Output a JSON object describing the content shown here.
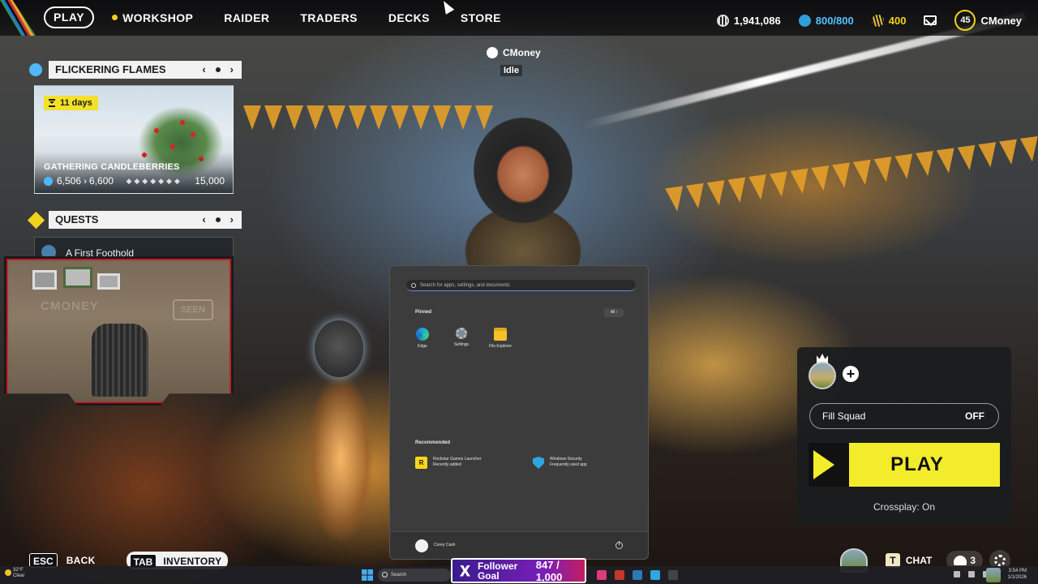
{
  "nav": {
    "play": "PLAY",
    "items": [
      "WORKSHOP",
      "RAIDER",
      "TRADERS",
      "DECKS",
      "STORE"
    ]
  },
  "currencies": {
    "coins": "1,941,086",
    "energy": "800/800",
    "tokens": "400"
  },
  "profile": {
    "level": "45",
    "username": "CMoney"
  },
  "player_tag": {
    "name": "CMoney",
    "status": "Idle"
  },
  "event": {
    "title": "FLICKERING FLAMES",
    "time_left": "11 days",
    "challenge": "GATHERING CANDLEBERRIES",
    "progress_current": "6,506",
    "progress_next": "6,600",
    "progress_max": "15,000"
  },
  "quests": {
    "title": "QUESTS",
    "first_quest": "A First Foothold"
  },
  "webcam": {
    "wall_text": "CMONEY",
    "sign_text": "SEEN"
  },
  "start_menu": {
    "search_placeholder": "Search for apps, settings, and documents",
    "pinned_label": "Pinned",
    "all_label": "All",
    "pinned_apps": [
      {
        "name": "Edge",
        "icon": "edge-icon"
      },
      {
        "name": "Settings",
        "icon": "settings-icon"
      },
      {
        "name": "File Explorer",
        "icon": "folder-icon"
      }
    ],
    "recommended_label": "Recommended",
    "recommended": [
      {
        "title": "Rockstar Games Launcher",
        "subtitle": "Recently added"
      },
      {
        "title": "Windows Security",
        "subtitle": "Frequently used app"
      }
    ],
    "user": "Corey Cash"
  },
  "squad": {
    "fill_squad_label": "Fill Squad",
    "fill_squad_value": "OFF",
    "play_label": "PLAY",
    "crossplay": "Crossplay: On"
  },
  "bottom": {
    "esc_key": "ESC",
    "back_label": "BACK",
    "tab_key": "TAB",
    "inventory_label": "INVENTORY",
    "chat_key": "T",
    "chat_label": "CHAT",
    "friends_count": "3"
  },
  "taskbar": {
    "temperature": "32°F",
    "weather": "Clear",
    "search": "Search",
    "time": "3:54 PM",
    "date": "1/1/2026"
  },
  "follower_goal": {
    "label": "Follower Goal",
    "count": "847 / 1,000"
  },
  "colors": {
    "accent_yellow": "#f3ec2a",
    "energy_blue": "#53c3ff",
    "token_gold": "#f3d21b"
  }
}
